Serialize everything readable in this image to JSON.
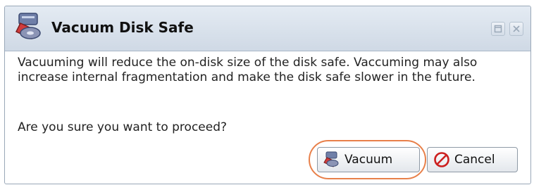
{
  "dialog": {
    "title": "Vacuum Disk Safe",
    "title_icon": "disk-safe-icon",
    "message": "Vacuuming will reduce the on-disk size of the disk safe. Vaccuming may also increase internal fragmentation and make the disk safe slower in the future.",
    "question": "Are you sure you want to proceed?",
    "window_controls": [
      "maximize-icon",
      "close-icon"
    ]
  },
  "buttons": {
    "vacuum": {
      "label": "Vacuum",
      "icon": "disk-safe-icon"
    },
    "cancel": {
      "label": "Cancel",
      "icon": "cancel-icon"
    }
  },
  "colors": {
    "titlebar": "#d9e2ec",
    "highlight": "#e8804a",
    "cancel_icon": "#cc1f1f"
  }
}
